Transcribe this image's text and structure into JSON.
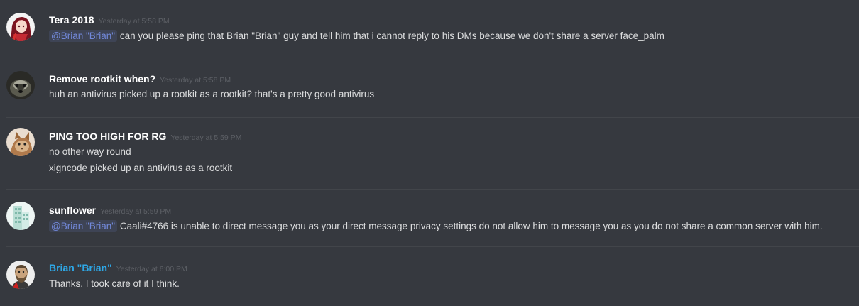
{
  "colors": {
    "background": "#36393f",
    "username_default": "#ffffff",
    "username_brian": "#2ea7e6",
    "mention": "#7289da",
    "timestamp": "#5d6066",
    "text": "#dcddde"
  },
  "messages": [
    {
      "author": "Tera 2018",
      "timestamp": "Yesterday at 5:58 PM",
      "avatar_icon": "anime-girl-avatar",
      "lines": [
        {
          "mention": "@Brian \"Brian\"",
          "text": "can you please ping that Brian \"Brian\" guy and tell him that i cannot reply to his DMs because we don't share a server face_palm"
        }
      ]
    },
    {
      "author": "Remove rootkit when?",
      "timestamp": "Yesterday at 5:58 PM",
      "avatar_icon": "badger-avatar",
      "lines": [
        {
          "text": "huh an antivirus picked up a rootkit as a rootkit? that's a pretty good antivirus"
        }
      ]
    },
    {
      "author": "PING TOO HIGH FOR RG",
      "timestamp": "Yesterday at 5:59 PM",
      "avatar_icon": "cat-avatar",
      "lines": [
        {
          "text": "no other way round"
        },
        {
          "text": "xigncode picked up an antivirus as a rootkit"
        }
      ]
    },
    {
      "author": "sunflower",
      "timestamp": "Yesterday at 5:59 PM",
      "avatar_icon": "building-avatar",
      "lines": [
        {
          "mention": "@Brian \"Brian\"",
          "text": "Caali#4766 is unable to direct message you as your direct message privacy settings do not allow him to message you as you do not share a common server with him."
        }
      ]
    },
    {
      "author": "Brian \"Brian\"",
      "timestamp": "Yesterday at 6:00 PM",
      "avatar_icon": "bearded-man-avatar",
      "lines": [
        {
          "text": "Thanks. I took care of it I think."
        }
      ]
    }
  ]
}
